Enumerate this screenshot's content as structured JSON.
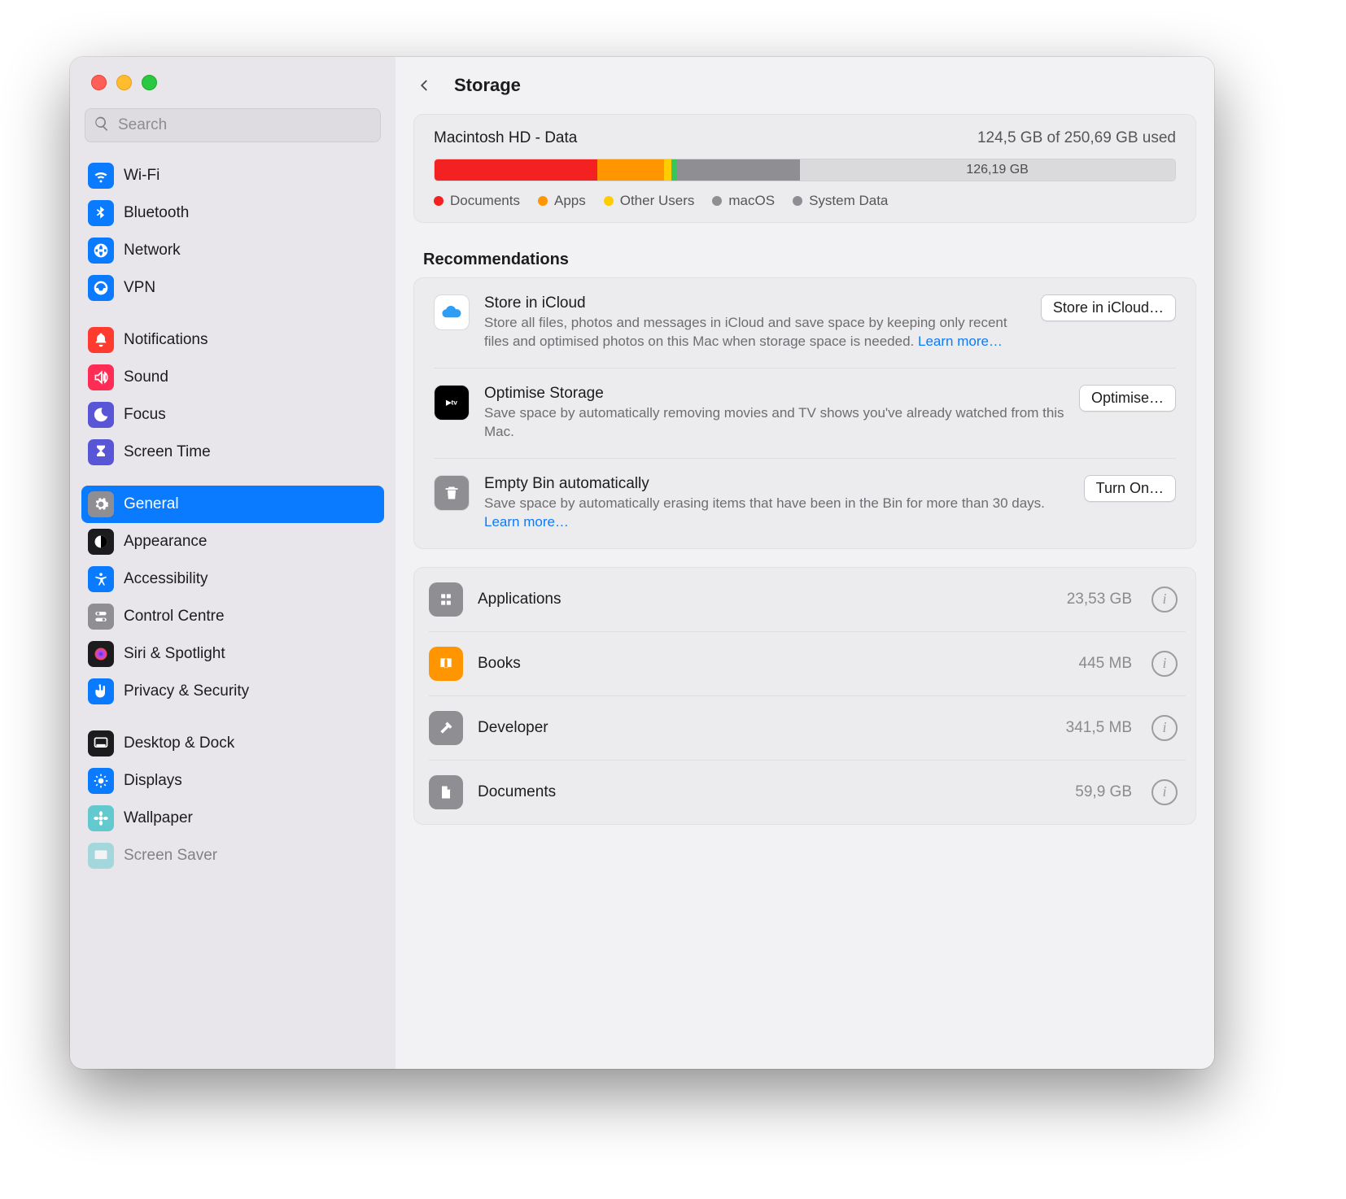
{
  "window": {
    "title": "Storage"
  },
  "search": {
    "placeholder": "Search"
  },
  "sidebar": {
    "groups": [
      [
        {
          "label": "Wi-Fi",
          "icon": "wifi",
          "color": "c-blue"
        },
        {
          "label": "Bluetooth",
          "icon": "bluetooth",
          "color": "c-blue"
        },
        {
          "label": "Network",
          "icon": "network",
          "color": "c-blue"
        },
        {
          "label": "VPN",
          "icon": "vpn",
          "color": "c-blue"
        }
      ],
      [
        {
          "label": "Notifications",
          "icon": "bell",
          "color": "c-red"
        },
        {
          "label": "Sound",
          "icon": "speaker",
          "color": "c-pink"
        },
        {
          "label": "Focus",
          "icon": "moon",
          "color": "c-purple"
        },
        {
          "label": "Screen Time",
          "icon": "hourglass",
          "color": "c-purple"
        }
      ],
      [
        {
          "label": "General",
          "icon": "gear",
          "color": "c-grey",
          "selected": true
        },
        {
          "label": "Appearance",
          "icon": "appearance",
          "color": "c-black"
        },
        {
          "label": "Accessibility",
          "icon": "accessibility",
          "color": "c-blue"
        },
        {
          "label": "Control Centre",
          "icon": "switches",
          "color": "c-grey"
        },
        {
          "label": "Siri & Spotlight",
          "icon": "siri",
          "color": "c-black"
        },
        {
          "label": "Privacy & Security",
          "icon": "hand",
          "color": "c-blue"
        }
      ],
      [
        {
          "label": "Desktop & Dock",
          "icon": "dock",
          "color": "c-black"
        },
        {
          "label": "Displays",
          "icon": "sun",
          "color": "c-blue"
        },
        {
          "label": "Wallpaper",
          "icon": "flower",
          "color": "c-teal"
        },
        {
          "label": "Screen Saver",
          "icon": "screensaver",
          "color": "c-teal",
          "partial": true
        }
      ]
    ]
  },
  "storage": {
    "disk_name": "Macintosh HD - Data",
    "usage_text": "124,5 GB of 250,69 GB used",
    "free_label": "126,19 GB",
    "segments": [
      {
        "class": "red",
        "pct": 22
      },
      {
        "class": "orange",
        "pct": 9
      },
      {
        "class": "yellow",
        "pct": 1
      },
      {
        "class": "green",
        "pct": 0.6
      },
      {
        "class": "grey1",
        "pct": 4
      },
      {
        "class": "stripe",
        "pct": 0.3
      },
      {
        "class": "grey2",
        "pct": 12.5
      },
      {
        "class": "free",
        "pct": 50.6
      }
    ],
    "legend": [
      {
        "dot": "red",
        "label": "Documents"
      },
      {
        "dot": "orange",
        "label": "Apps"
      },
      {
        "dot": "yellow",
        "label": "Other Users"
      },
      {
        "dot": "grey",
        "label": "macOS"
      },
      {
        "dot": "grey",
        "label": "System Data"
      }
    ]
  },
  "recommendations": {
    "heading": "Recommendations",
    "items": [
      {
        "title": "Store in iCloud",
        "desc": "Store all files, photos and messages in iCloud and save space by keeping only recent files and optimised photos on this Mac when storage space is needed. ",
        "link": "Learn more…",
        "button": "Store in iCloud…",
        "icon": "icloud",
        "icon_bg": "#ffffff",
        "icon_fg": "#2e9df6"
      },
      {
        "title": "Optimise Storage",
        "desc": "Save space by automatically removing movies and TV shows you've already watched from this Mac.",
        "link": "",
        "button": "Optimise…",
        "icon": "tv",
        "icon_bg": "#000000",
        "icon_fg": "#ffffff"
      },
      {
        "title": "Empty Bin automatically",
        "desc": "Save space by automatically erasing items that have been in the Bin for more than 30 days. ",
        "link": "Learn more…",
        "button": "Turn On…",
        "icon": "trash",
        "icon_bg": "#8e8e93",
        "icon_fg": "#ffffff"
      }
    ]
  },
  "categories": [
    {
      "name": "Applications",
      "size": "23,53 GB",
      "icon": "apps",
      "bg": "#8e8e93"
    },
    {
      "name": "Books",
      "size": "445 MB",
      "icon": "book",
      "bg": "#ff9500"
    },
    {
      "name": "Developer",
      "size": "341,5 MB",
      "icon": "hammer",
      "bg": "#8e8e93"
    },
    {
      "name": "Documents",
      "size": "59,9 GB",
      "icon": "doc",
      "bg": "#8e8e93"
    }
  ]
}
